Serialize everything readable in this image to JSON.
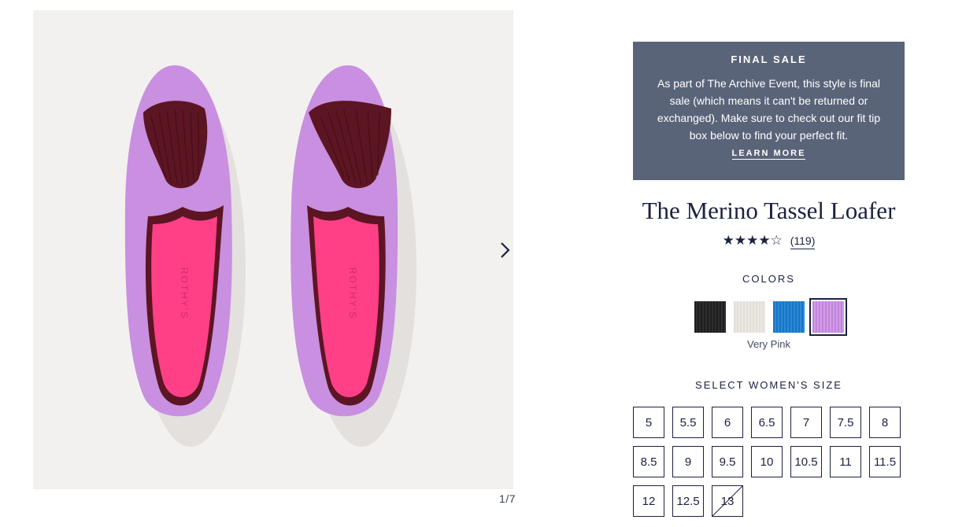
{
  "gallery": {
    "counter": "1/7",
    "next_icon": "chevron-right-icon",
    "brand_imprint": "ROTHY'S"
  },
  "notice": {
    "title": "FINAL SALE",
    "body": "As part of The Archive Event, this style is final sale (which means it can't be returned or exchanged). Make sure to check out our fit tip box below to find your perfect fit.",
    "link": "LEARN MORE",
    "bg_color": "#5a6479"
  },
  "product": {
    "title": "The Merino Tassel Loafer",
    "rating": 4.5,
    "stars": "★★★★☆",
    "reviews": "(119)"
  },
  "colors": {
    "label": "COLORS",
    "selected_name": "Very Pink",
    "swatches": [
      {
        "name": "Black",
        "hex": "#232323"
      },
      {
        "name": "Cream",
        "hex": "#e7e3dc"
      },
      {
        "name": "Blue",
        "hex": "#1f7fd0"
      },
      {
        "name": "Very Pink",
        "hex": "#c98fe0",
        "selected": true
      }
    ]
  },
  "sizes": {
    "label": "SELECT WOMEN'S SIZE",
    "options": [
      {
        "label": "5",
        "available": true
      },
      {
        "label": "5.5",
        "available": true
      },
      {
        "label": "6",
        "available": true
      },
      {
        "label": "6.5",
        "available": true
      },
      {
        "label": "7",
        "available": true
      },
      {
        "label": "7.5",
        "available": true
      },
      {
        "label": "8",
        "available": true
      },
      {
        "label": "8.5",
        "available": true
      },
      {
        "label": "9",
        "available": true
      },
      {
        "label": "9.5",
        "available": true
      },
      {
        "label": "10",
        "available": true
      },
      {
        "label": "10.5",
        "available": true
      },
      {
        "label": "11",
        "available": true
      },
      {
        "label": "11.5",
        "available": true
      },
      {
        "label": "12",
        "available": true
      },
      {
        "label": "12.5",
        "available": true
      },
      {
        "label": "13",
        "available": false
      }
    ]
  },
  "palette": {
    "navy": "#1b2140",
    "shoe_lilac": "#c98fe0",
    "insole_pink": "#ff3f86",
    "tassel": "#5c1522"
  }
}
